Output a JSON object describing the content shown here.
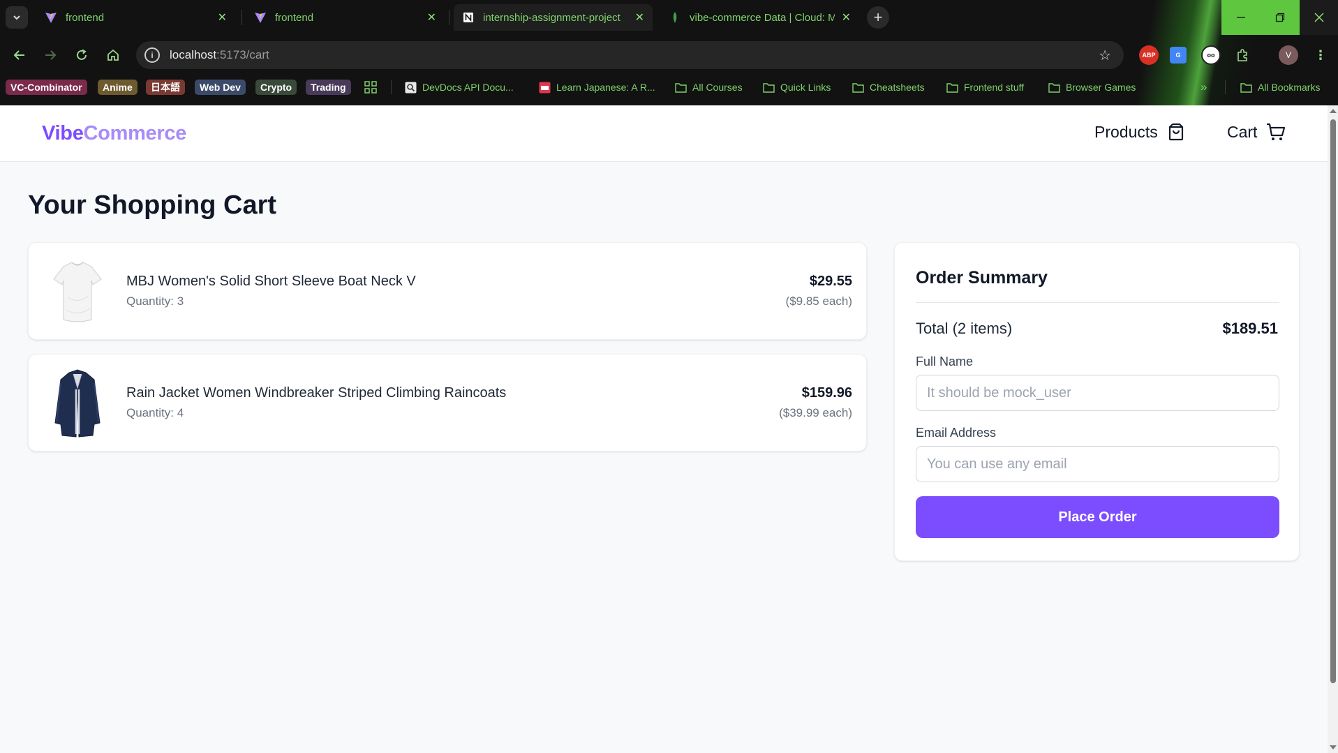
{
  "browser": {
    "tabs": [
      {
        "title": "frontend",
        "icon": "vite-icon"
      },
      {
        "title": "frontend",
        "icon": "vite-icon"
      },
      {
        "title": "internship-assignment-project",
        "icon": "notion-icon"
      },
      {
        "title": "vibe-commerce Data | Cloud: M",
        "icon": "mongodb-icon"
      }
    ],
    "url_host": "localhost",
    "url_path": ":5173/cart",
    "bookmarks": {
      "chips": [
        {
          "label": "VC-Combinator",
          "bg": "#7a2a4a",
          "fg": "#ffffff"
        },
        {
          "label": "Anime",
          "bg": "#6e5a2f",
          "fg": "#ffffff"
        },
        {
          "label": "日本語",
          "bg": "#7a3a32",
          "fg": "#ffffff"
        },
        {
          "label": "Web Dev",
          "bg": "#3c4a6a",
          "fg": "#ffffff"
        },
        {
          "label": "Crypto",
          "bg": "#3a4a3a",
          "fg": "#ffffff"
        },
        {
          "label": "Trading",
          "bg": "#4a3a5a",
          "fg": "#ffffff"
        }
      ],
      "links": [
        {
          "label": "DevDocs API Docu...",
          "icon": "devdocs-icon"
        },
        {
          "label": "Learn Japanese: A R...",
          "icon": "tofugu-icon"
        },
        {
          "label": "All Courses",
          "icon": "folder-icon"
        },
        {
          "label": "Quick Links",
          "icon": "folder-icon"
        },
        {
          "label": "Cheatsheets",
          "icon": "folder-icon"
        },
        {
          "label": "Frontend stuff",
          "icon": "folder-icon"
        },
        {
          "label": "Browser Games",
          "icon": "folder-icon"
        }
      ],
      "all_bookmarks": "All Bookmarks"
    },
    "extensions": {
      "abp": "ABP",
      "profile": "V"
    }
  },
  "site": {
    "logo_part1": "Vibe",
    "logo_part2": "Commerce",
    "nav": {
      "products": "Products",
      "cart": "Cart"
    }
  },
  "cart": {
    "title": "Your Shopping Cart",
    "items": [
      {
        "name": "MBJ Women's Solid Short Sleeve Boat Neck V",
        "quantity": "Quantity: 3",
        "price": "$29.55",
        "each": "($9.85 each)"
      },
      {
        "name": "Rain Jacket Women Windbreaker Striped Climbing Raincoats",
        "quantity": "Quantity: 4",
        "price": "$159.96",
        "each": "($39.99 each)"
      }
    ]
  },
  "summary": {
    "title": "Order Summary",
    "total_label": "Total (2 items)",
    "total_value": "$189.51",
    "name_label": "Full Name",
    "name_placeholder": "It should be mock_user",
    "email_label": "Email Address",
    "email_placeholder": "You can use any email",
    "button": "Place Order"
  },
  "colors": {
    "accent": "#7c4dff",
    "accent_light": "#a78bfa",
    "chrome_green": "#7fd36b"
  }
}
